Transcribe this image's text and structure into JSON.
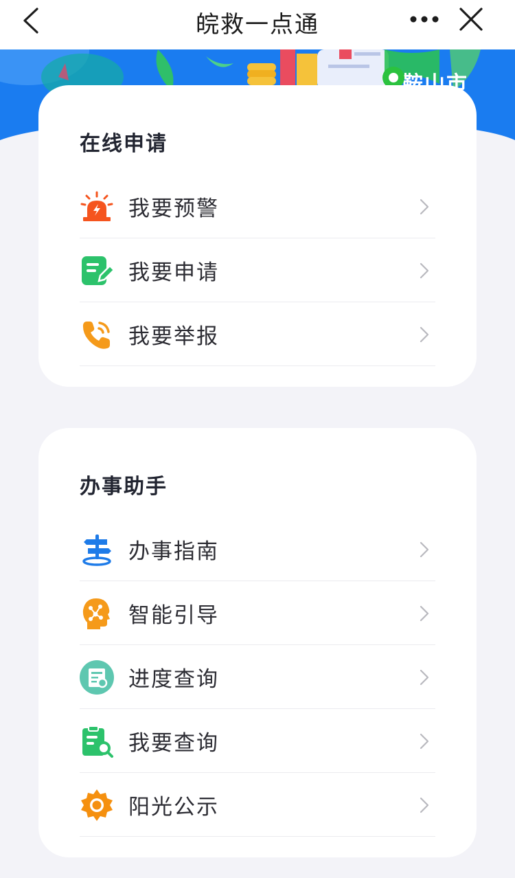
{
  "navbar": {
    "title": "皖救一点通",
    "back_icon": "chevron-left-icon",
    "more_icon": "more-horizontal-icon",
    "close_icon": "close-icon"
  },
  "banner": {
    "city": "马鞍山市",
    "pin_icon": "location-pin-icon",
    "colors": {
      "sky": "#1a7cf0",
      "pin": "#2bc23f"
    }
  },
  "sections": [
    {
      "title": "在线申请",
      "items": [
        {
          "label": "我要预警",
          "icon": "alarm-siren-icon",
          "color": "#f5541e"
        },
        {
          "label": "我要申请",
          "icon": "edit-form-icon",
          "color": "#2cc26b"
        },
        {
          "label": "我要举报",
          "icon": "phone-call-icon",
          "color": "#f59a1a"
        }
      ]
    },
    {
      "title": "办事助手",
      "items": [
        {
          "label": "办事指南",
          "icon": "signpost-icon",
          "color": "#1e7be8"
        },
        {
          "label": "智能引导",
          "icon": "ai-head-icon",
          "color": "#f59a1a"
        },
        {
          "label": "进度查询",
          "icon": "id-card-search-icon",
          "color": "#5ec7b0"
        },
        {
          "label": "我要查询",
          "icon": "clipboard-search-icon",
          "color": "#2cc26b"
        },
        {
          "label": "阳光公示",
          "icon": "sun-icon",
          "color": "#f5900f"
        }
      ]
    }
  ]
}
